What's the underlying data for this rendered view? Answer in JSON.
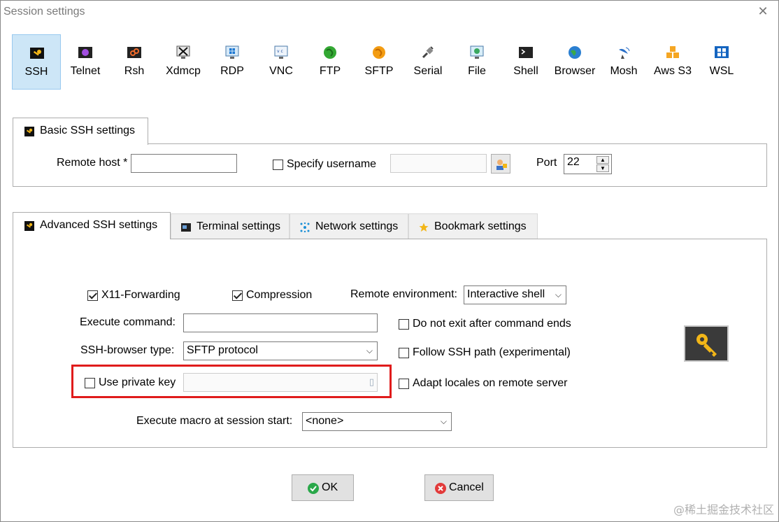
{
  "window": {
    "title": "Session settings",
    "close": "✕"
  },
  "session_types": [
    {
      "label": "SSH",
      "icon": "ssh-key-icon",
      "selected": true
    },
    {
      "label": "Telnet",
      "icon": "telnet-icon"
    },
    {
      "label": "Rsh",
      "icon": "rsh-icon"
    },
    {
      "label": "Xdmcp",
      "icon": "xdmcp-icon"
    },
    {
      "label": "RDP",
      "icon": "rdp-icon"
    },
    {
      "label": "VNC",
      "icon": "vnc-icon"
    },
    {
      "label": "FTP",
      "icon": "ftp-globe-icon"
    },
    {
      "label": "SFTP",
      "icon": "sftp-icon"
    },
    {
      "label": "Serial",
      "icon": "serial-plug-icon"
    },
    {
      "label": "File",
      "icon": "file-monitor-icon"
    },
    {
      "label": "Shell",
      "icon": "shell-terminal-icon"
    },
    {
      "label": "Browser",
      "icon": "browser-globe-icon"
    },
    {
      "label": "Mosh",
      "icon": "mosh-satellite-icon"
    },
    {
      "label": "Aws S3",
      "icon": "aws-s3-cubes-icon"
    },
    {
      "label": "WSL",
      "icon": "wsl-windows-icon"
    }
  ],
  "basic": {
    "tab_label": "Basic SSH settings",
    "remote_host_label": "Remote host *",
    "remote_host_value": "",
    "specify_username_label": "Specify username",
    "username_value": "",
    "port_label": "Port",
    "port_value": "22"
  },
  "tabs": [
    {
      "label": "Advanced SSH settings",
      "icon": "ssh-key-icon",
      "active": true
    },
    {
      "label": "Terminal settings",
      "icon": "terminal-icon"
    },
    {
      "label": "Network settings",
      "icon": "network-icon"
    },
    {
      "label": "Bookmark settings",
      "icon": "star-icon"
    }
  ],
  "advanced": {
    "x11_label": "X11-Forwarding",
    "compression_label": "Compression",
    "remote_env_label": "Remote environment:",
    "remote_env_value": "Interactive shell",
    "exec_cmd_label": "Execute command:",
    "exec_cmd_value": "",
    "no_exit_label": "Do not exit after command ends",
    "browser_type_label": "SSH-browser type:",
    "browser_type_value": "SFTP protocol",
    "follow_path_label": "Follow SSH path (experimental)",
    "private_key_label": "Use private key",
    "adapt_locales_label": "Adapt locales on remote server",
    "macro_label": "Execute macro at session start:",
    "macro_value": "<none>"
  },
  "buttons": {
    "ok": "OK",
    "cancel": "Cancel"
  },
  "watermark": "@稀土掘金技术社区",
  "colors": {
    "selected_bg": "#cde6f7",
    "highlight_red": "#e01b1b",
    "ok_green": "#2aa84a",
    "cancel_red": "#e23a3a"
  }
}
